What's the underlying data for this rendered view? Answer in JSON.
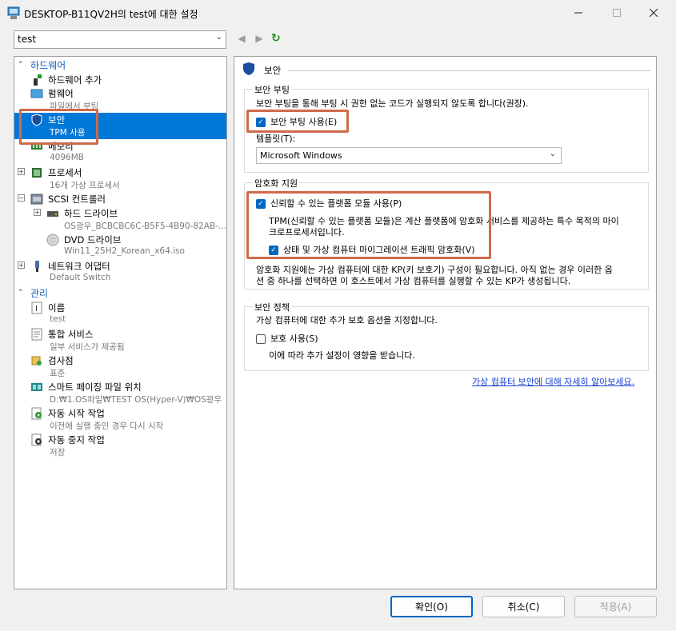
{
  "window": {
    "title": "DESKTOP-B11QV2H의 test에 대한 설정"
  },
  "vm_select": {
    "value": "test"
  },
  "tree": {
    "hardware_header": "하드웨어",
    "management_header": "관리",
    "items": [
      {
        "label": "하드웨어 추가",
        "sub": ""
      },
      {
        "label": "펌웨어",
        "sub": "파일에서 부팅"
      },
      {
        "label": "보안",
        "sub": "TPM 사용"
      },
      {
        "label": "메모리",
        "sub": "4096MB"
      },
      {
        "label": "프로세서",
        "sub": "16개 가상 프로세서"
      },
      {
        "label": "SCSI 컨트롤러",
        "sub": ""
      },
      {
        "label": "하드 드라이브",
        "sub": "OS광우_BCBCBC6C-B5F5-4B90-82AB-..."
      },
      {
        "label": "DVD 드라이브",
        "sub": "Win11_25H2_Korean_x64.iso"
      },
      {
        "label": "네트워크 어댑터",
        "sub": "Default Switch"
      },
      {
        "label": "이름",
        "sub": "test"
      },
      {
        "label": "통합 서비스",
        "sub": "일부 서비스가 제공됨"
      },
      {
        "label": "검사점",
        "sub": "표준"
      },
      {
        "label": "스마트 페이징 파일 위치",
        "sub": "D:₩1.OS파일₩TEST OS(Hyper-V)₩OS광우"
      },
      {
        "label": "자동 시작 작업",
        "sub": "이전에 실행 중인 경우 다시 시작"
      },
      {
        "label": "자동 중지 작업",
        "sub": "저장"
      }
    ]
  },
  "security": {
    "title": "보안",
    "secure_boot": {
      "group_title": "보안 부팅",
      "description": "보안 부팅을 통해 부팅 시 권한 없는 코드가 실행되지 않도록 합니다(권장).",
      "checkbox_label": "보안 부팅 사용(E)",
      "checked": true,
      "template_label": "템플릿(T):",
      "template_value": "Microsoft Windows"
    },
    "encryption": {
      "group_title": "암호화 지원",
      "tpm_label": "신뢰할 수 있는 플랫폼 모듈 사용(P)",
      "tpm_checked": true,
      "tpm_desc_1": "TPM(신뢰할 수 있는 플랫폼 모듈)은 계산 플랫폼에 암호화 서비스를 제공하는 특수 목적의 마이",
      "tpm_desc_2": "크로프로세서입니다.",
      "migration_label": "상태 및 가상 컴퓨터 마이그레이션 트래픽 암호화(V)",
      "migration_checked": true,
      "note_1": "암호화 지원에는 가상 컴퓨터에 대한 KP(키 보호기) 구성이 필요합니다. 아직 없는 경우 이러한 옵",
      "note_2": "션 중 하나를 선택하면 이 호스트에서 가상 컴퓨터를 실행할 수 있는 KP가 생성됩니다."
    },
    "policy": {
      "group_title": "보안 정책",
      "description": "가상 컴퓨터에 대한 추가 보호 옵션을 지정합니다.",
      "checkbox_label": "보호 사용(S)",
      "checked": false,
      "note": "이에 따라 추가 설정이 영향을 받습니다."
    },
    "learn_more": "가상 컴퓨터 보안에 대해 자세히 알아보세요."
  },
  "buttons": {
    "ok": "확인(O)",
    "cancel": "취소(C)",
    "apply": "적용(A)"
  },
  "colors": {
    "accent": "#0078d7",
    "highlight_box": "#d06a4a",
    "link": "#1a3fd1"
  }
}
